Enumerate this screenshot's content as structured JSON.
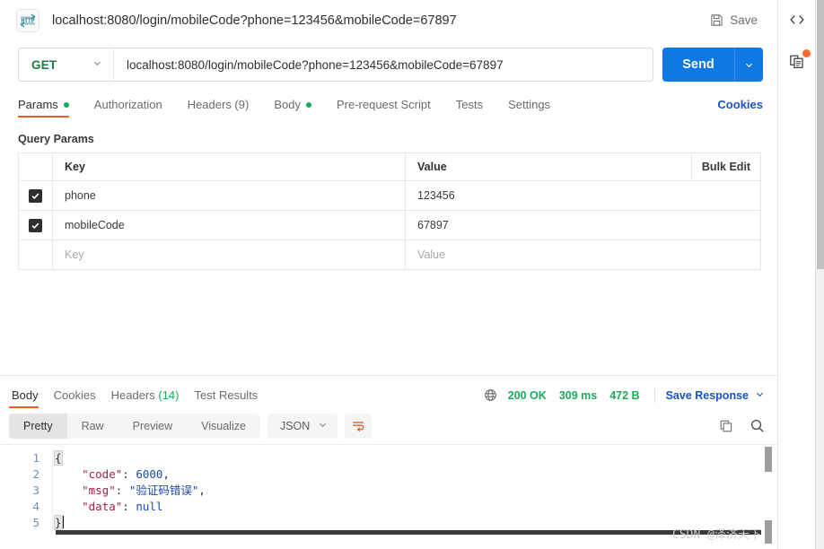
{
  "request_header": {
    "protocol_icon": "http-icon",
    "title": "localhost:8080/login/mobileCode?phone=123456&mobileCode=67897",
    "save_label": "Save",
    "save_icon": "floppy-disk-icon"
  },
  "url_bar": {
    "method": "GET",
    "url": "localhost:8080/login/mobileCode?phone=123456&mobileCode=67897",
    "send_label": "Send"
  },
  "request_tabs": {
    "items": [
      {
        "label": "Params",
        "active": true,
        "dot": true
      },
      {
        "label": "Authorization",
        "active": false,
        "dot": false
      },
      {
        "label": "Headers (9)",
        "active": false,
        "dot": false
      },
      {
        "label": "Body",
        "active": false,
        "dot": true
      },
      {
        "label": "Pre-request Script",
        "active": false,
        "dot": false
      },
      {
        "label": "Tests",
        "active": false,
        "dot": false
      },
      {
        "label": "Settings",
        "active": false,
        "dot": false
      }
    ],
    "cookies_label": "Cookies"
  },
  "query_params": {
    "section_label": "Query Params",
    "columns": {
      "key": "Key",
      "value": "Value",
      "bulk_edit": "Bulk Edit"
    },
    "rows": [
      {
        "checked": true,
        "key": "phone",
        "value": "123456"
      },
      {
        "checked": true,
        "key": "mobileCode",
        "value": "67897"
      }
    ],
    "empty_row": {
      "key_placeholder": "Key",
      "value_placeholder": "Value"
    }
  },
  "response": {
    "tabs": [
      {
        "label": "Body",
        "count": "",
        "active": true
      },
      {
        "label": "Cookies",
        "count": "",
        "active": false
      },
      {
        "label": "Headers",
        "count": "(14)",
        "active": false
      },
      {
        "label": "Test Results",
        "count": "",
        "active": false
      }
    ],
    "status": {
      "globe_icon": "globe-icon",
      "code": "200 OK",
      "time": "309 ms",
      "size": "472 B",
      "save_response_label": "Save Response"
    },
    "toolbar": {
      "view_modes": [
        {
          "label": "Pretty",
          "active": true
        },
        {
          "label": "Raw",
          "active": false
        },
        {
          "label": "Preview",
          "active": false
        },
        {
          "label": "Visualize",
          "active": false
        }
      ],
      "format": "JSON",
      "wrap_icon": "word-wrap-icon",
      "copy_icon": "copy-icon",
      "search_icon": "search-icon"
    },
    "body": {
      "language": "json",
      "lines": [
        {
          "n": "1",
          "tokens": [
            {
              "t": "{",
              "c": "brace"
            }
          ]
        },
        {
          "n": "2",
          "tokens": [
            {
              "t": "    ",
              "c": "plain"
            },
            {
              "t": "\"code\"",
              "c": "key"
            },
            {
              "t": ": ",
              "c": "punct"
            },
            {
              "t": "6000",
              "c": "num"
            },
            {
              "t": ",",
              "c": "punct"
            }
          ]
        },
        {
          "n": "3",
          "tokens": [
            {
              "t": "    ",
              "c": "plain"
            },
            {
              "t": "\"msg\"",
              "c": "key"
            },
            {
              "t": ": ",
              "c": "punct"
            },
            {
              "t": "\"验证码错误\"",
              "c": "str"
            },
            {
              "t": ",",
              "c": "punct"
            }
          ]
        },
        {
          "n": "4",
          "tokens": [
            {
              "t": "    ",
              "c": "plain"
            },
            {
              "t": "\"data\"",
              "c": "key"
            },
            {
              "t": ": ",
              "c": "punct"
            },
            {
              "t": "null",
              "c": "null"
            }
          ]
        },
        {
          "n": "5",
          "tokens": [
            {
              "t": "}",
              "c": "brace"
            }
          ]
        }
      ]
    }
  },
  "right_rail": {
    "code_icon": "code-snippet-icon",
    "docs_icon": "documentation-icon",
    "docs_badge": true
  },
  "watermark": "CSDN @泽济天下",
  "colors": {
    "accent_orange": "#ef5b25",
    "send_blue": "#1078e4",
    "link_blue": "#1455c2",
    "status_green": "#1bab5b",
    "method_green": "#1d7a43",
    "badge_orange": "#ff6b2c"
  }
}
